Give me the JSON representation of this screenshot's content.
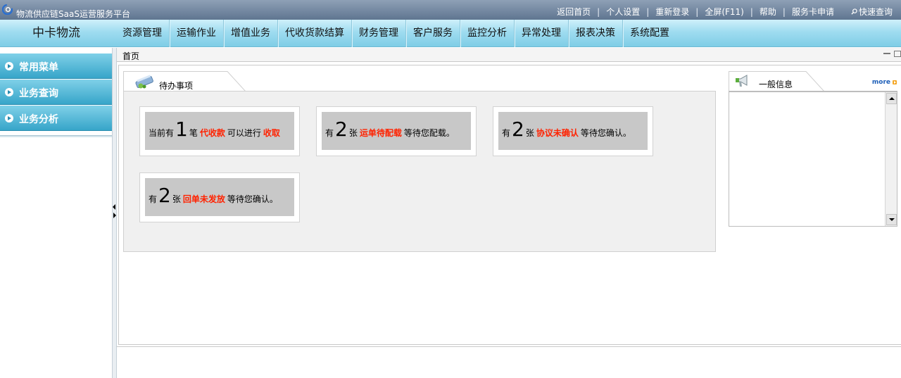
{
  "app": {
    "title": "物流供应链SaaS运营服务平台",
    "brand": "中卡物流"
  },
  "top_links": {
    "home": "返回首页",
    "settings": "个人设置",
    "relogin": "重新登录",
    "fullscreen": "全屏(F11)",
    "help": "帮助",
    "service_card": "服务卡申请",
    "quick_search": "快速查询",
    "separator": "|"
  },
  "nav": [
    "资源管理",
    "运输作业",
    "增值业务",
    "代收货款结算",
    "财务管理",
    "客户服务",
    "监控分析",
    "异常处理",
    "报表决策",
    "系统配置"
  ],
  "sidebar": {
    "items": [
      {
        "label": "常用菜单"
      },
      {
        "label": "业务查询"
      },
      {
        "label": "业务分析"
      }
    ]
  },
  "tabs": {
    "home": "首页"
  },
  "todo": {
    "title": "待办事项",
    "cards": [
      {
        "prefix": "当前有",
        "num": "1",
        "unit": "笔",
        "highlight": "代收款",
        "middle": "可以进行",
        "highlight2": "收取",
        "suffix": ""
      },
      {
        "prefix": "有",
        "num": "2",
        "unit": "张",
        "highlight": "运单待配载",
        "middle": "等待您配载。",
        "highlight2": "",
        "suffix": ""
      },
      {
        "prefix": "有",
        "num": "2",
        "unit": "张",
        "highlight": "协议未确认",
        "middle": "等待您确认。",
        "highlight2": "",
        "suffix": ""
      },
      {
        "prefix": "有",
        "num": "2",
        "unit": "张",
        "highlight": "回单未发放",
        "middle": "等待您确认。",
        "highlight2": "",
        "suffix": ""
      }
    ]
  },
  "info": {
    "title": "一般信息",
    "more": "more"
  },
  "colors": {
    "highlight": "#ff2200",
    "nav_bg": "#9fdcf0",
    "sidebar_bg": "#37a5c9",
    "title_bar": "#5f7590",
    "more_link": "#1e5fb8"
  },
  "icons": [
    "app-logo-icon",
    "search-icon",
    "todo-icon",
    "megaphone-icon",
    "scroll-up-icon",
    "scroll-down-icon"
  ]
}
